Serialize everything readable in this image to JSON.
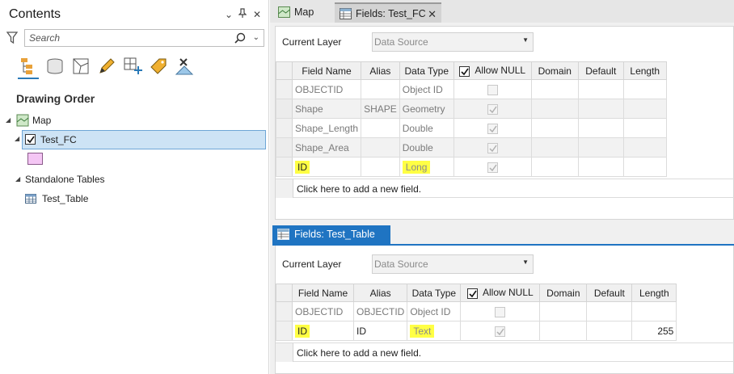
{
  "contents": {
    "title": "Contents",
    "search_placeholder": "Search",
    "section_heading": "Drawing Order",
    "tree": {
      "map_label": "Map",
      "layer_label": "Test_FC",
      "standalone_label": "Standalone Tables",
      "table_label": "Test_Table"
    },
    "toolbar_icons": [
      "list-by-drawing-order-icon",
      "list-by-data-source-icon",
      "list-by-selection-icon",
      "list-by-editing-icon",
      "list-by-snapping-icon",
      "list-by-labeling-icon",
      "list-by-perspective-icon"
    ],
    "symbol_color": "#f4c6f4"
  },
  "tabs": {
    "map_tab": "Map",
    "fields_fc_tab": "Fields:  Test_FC",
    "fields_table_tab": "Fields:  Test_Table"
  },
  "fc_view": {
    "current_layer_label": "Current Layer",
    "data_source_value": "Data Source",
    "columns": [
      "Field Name",
      "Alias",
      "Data Type",
      "Allow NULL",
      "Domain",
      "Default",
      "Length"
    ],
    "rows": [
      {
        "field": "OBJECTID",
        "alias": "",
        "type": "Object ID",
        "allow_null": false,
        "domain": "",
        "default": "",
        "length": "",
        "highlighted": false
      },
      {
        "field": "Shape",
        "alias": "SHAPE",
        "type": "Geometry",
        "allow_null": true,
        "domain": "",
        "default": "",
        "length": "",
        "highlighted": false
      },
      {
        "field": "Shape_Length",
        "alias": "",
        "type": "Double",
        "allow_null": true,
        "domain": "",
        "default": "",
        "length": "",
        "highlighted": false
      },
      {
        "field": "Shape_Area",
        "alias": "",
        "type": "Double",
        "allow_null": true,
        "domain": "",
        "default": "",
        "length": "",
        "highlighted": false
      },
      {
        "field": "ID",
        "alias": "",
        "type": "Long",
        "allow_null": true,
        "domain": "",
        "default": "",
        "length": "",
        "highlighted": true
      }
    ],
    "add_field_text": "Click here to add a new field."
  },
  "table_view": {
    "current_layer_label": "Current Layer",
    "data_source_value": "Data Source",
    "columns": [
      "Field Name",
      "Alias",
      "Data Type",
      "Allow NULL",
      "Domain",
      "Default",
      "Length"
    ],
    "rows": [
      {
        "field": "OBJECTID",
        "alias": "OBJECTID",
        "type": "Object ID",
        "allow_null": false,
        "domain": "",
        "default": "",
        "length": "",
        "highlighted": false
      },
      {
        "field": "ID",
        "alias": "ID",
        "type": "Text",
        "allow_null": true,
        "domain": "",
        "default": "",
        "length": "255",
        "highlighted": true
      }
    ],
    "add_field_text": "Click here to add a new field."
  },
  "colors": {
    "highlight": "#ffff44",
    "accent": "#1f74c2",
    "selection": "#cde3f5"
  }
}
